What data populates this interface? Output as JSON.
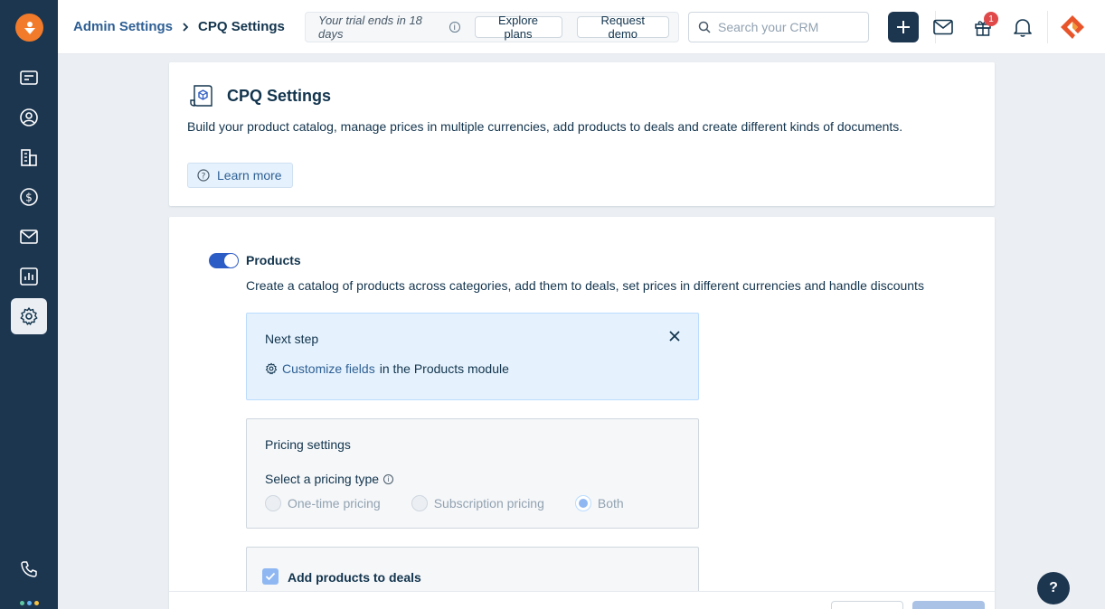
{
  "header": {
    "breadcrumb_parent": "Admin Settings",
    "breadcrumb_current": "CPQ Settings",
    "trial_text": "Your trial ends in 18 days",
    "explore_plans": "Explore plans",
    "request_demo": "Request demo",
    "search_placeholder": "Search your CRM",
    "notification_count": "1"
  },
  "sidebar": {
    "items": [
      "deals-icon",
      "contacts-icon",
      "accounts-icon",
      "sales-icon",
      "mail-icon",
      "reports-icon",
      "settings-icon",
      "phone-icon"
    ]
  },
  "cpq": {
    "title": "CPQ Settings",
    "description": "Build your product catalog, manage prices in multiple currencies, add products to deals and create different kinds of documents.",
    "learn_more": "Learn more"
  },
  "products": {
    "title": "Products",
    "description": "Create a catalog of products across categories, add them to deals, set prices in different currencies and handle discounts",
    "enabled": true
  },
  "next_step": {
    "title": "Next step",
    "link_text": "Customize fields",
    "suffix_text": "in the Products module"
  },
  "pricing": {
    "title": "Pricing settings",
    "label": "Select a pricing type",
    "options": [
      "One-time pricing",
      "Subscription pricing",
      "Both"
    ],
    "selected": "Both"
  },
  "deals": {
    "label": "Add products to deals",
    "checked": true
  },
  "help_label": "?",
  "colors": {
    "sidebar": "#1d3650",
    "accent": "#2c5cc5",
    "brand_orange": "#f17b2a",
    "badge": "#e0494a"
  }
}
